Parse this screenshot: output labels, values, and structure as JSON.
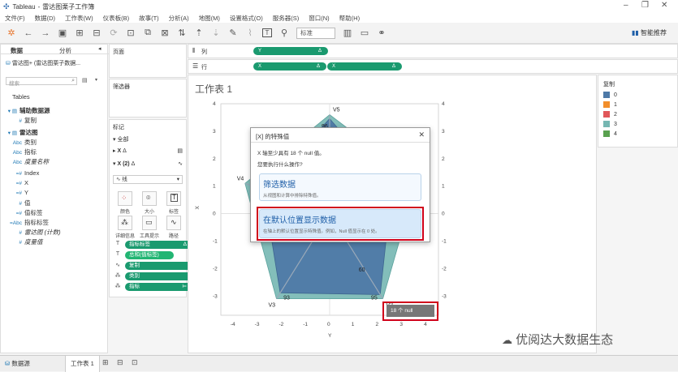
{
  "titlebar": {
    "app": "Tableau",
    "doc": "雷达图栗子工作簿"
  },
  "menu": [
    "文件(F)",
    "数据(D)",
    "工作表(W)",
    "仪表板(B)",
    "故事(T)",
    "分析(A)",
    "地图(M)",
    "设置格式(O)",
    "服务器(S)",
    "窗口(N)",
    "帮助(H)"
  ],
  "toolbar": {
    "view_select": "标准",
    "smart": "智能推荐"
  },
  "datapane": {
    "tabs": [
      "数据",
      "分析"
    ],
    "source": "雷达图+ (雷达图栗子数据...",
    "search_placeholder": "搜索",
    "tables_label": "Tables",
    "fields": [
      {
        "icon": "▤",
        "label": "辅助数据源",
        "bold": true
      },
      {
        "icon": "#",
        "label": "复制"
      },
      {
        "icon": "▤",
        "label": "雷达图",
        "bold": true
      },
      {
        "icon": "Abc",
        "label": "类别"
      },
      {
        "icon": "Abc",
        "label": "指标"
      },
      {
        "icon": "Abc",
        "label": "度量名称",
        "italic": true
      },
      {
        "icon": "=#",
        "label": "Index"
      },
      {
        "icon": "=#",
        "label": "X"
      },
      {
        "icon": "=#",
        "label": "Y"
      },
      {
        "icon": "#",
        "label": "值"
      },
      {
        "icon": "=#",
        "label": "值标签"
      },
      {
        "icon": "=Abc",
        "label": "指标标签"
      },
      {
        "icon": "#",
        "label": "雷达图 (计数)",
        "italic": true
      },
      {
        "icon": "#",
        "label": "度量值",
        "italic": true
      }
    ]
  },
  "shelves": {
    "pages": "页面",
    "filters": "筛选器",
    "columns_label": "列",
    "rows_label": "行",
    "columns_pill": "Y",
    "rows_pills": [
      "X",
      "X"
    ]
  },
  "marks": {
    "title": "标记",
    "all": "全部",
    "x_layer": "X",
    "x2_layer": "X (2)",
    "mark_type": "线",
    "buttons": [
      "颜色",
      "大小",
      "标签",
      "详细信息",
      "工具提示",
      "路径"
    ],
    "pills": [
      {
        "icon": "T",
        "label": "指标标签"
      },
      {
        "icon": "T",
        "label": "总和(值标签)"
      },
      {
        "icon": "∿",
        "label": "复制"
      },
      {
        "icon": "⁂",
        "label": "类别"
      },
      {
        "icon": "⁂",
        "label": "指标"
      }
    ]
  },
  "sheet": {
    "title": "工作表 1",
    "x_axis_label": "Y",
    "y_axis_label": "X",
    "x_ticks": [
      "-4",
      "-3",
      "-2",
      "-1",
      "0",
      "1",
      "2",
      "3",
      "4"
    ],
    "y_ticks": [
      "4",
      "3",
      "2",
      "1",
      "0",
      "-1",
      "-2",
      "-3"
    ]
  },
  "chart_data": {
    "type": "area",
    "xlabel": "Y",
    "ylabel": "X",
    "xlim": [
      -4.5,
      4.5
    ],
    "ylim": [
      -3.7,
      4.0
    ],
    "vertices": [
      {
        "name": "V5",
        "x": 0,
        "y": 3.6,
        "value": 96
      },
      {
        "name": "V4",
        "x": -3.5,
        "y": 1.1,
        "value": 78
      },
      {
        "name": "V3",
        "x": -2.2,
        "y": -3.1,
        "value": 93
      },
      {
        "name": "V2",
        "x": 2.2,
        "y": -3.1,
        "value": 95
      },
      {
        "name": "V1",
        "x": 3.6,
        "y": 1.2,
        "value": 71
      }
    ],
    "inner_label": {
      "x": 1.2,
      "y": -2.1,
      "value": 60
    },
    "legend_title": "复制",
    "legend": [
      {
        "label": "0",
        "color": "#4e79a7"
      },
      {
        "label": "1",
        "color": "#f28e2b"
      },
      {
        "label": "2",
        "color": "#e15759"
      },
      {
        "label": "3",
        "color": "#76b7b2"
      },
      {
        "label": "4",
        "color": "#59a14f"
      }
    ],
    "null_indicator": "18 个 null"
  },
  "dialog": {
    "title": "[X] 的特殊值",
    "line1": "X 轴至少具有 18 个 null 值。",
    "line2": "您要执行什么操作?",
    "opt1_title": "筛选数据",
    "opt1_desc": "从视图和计算中排除特殊值。",
    "opt2_title": "在默认位置显示数据",
    "opt2_desc": "在轴上的默认位置显示特殊值。例如，Null 值显示在 0 处。"
  },
  "bottom": {
    "tabs": [
      "数据源",
      "工作表 1"
    ]
  },
  "watermark": "优阅达大数据生态"
}
